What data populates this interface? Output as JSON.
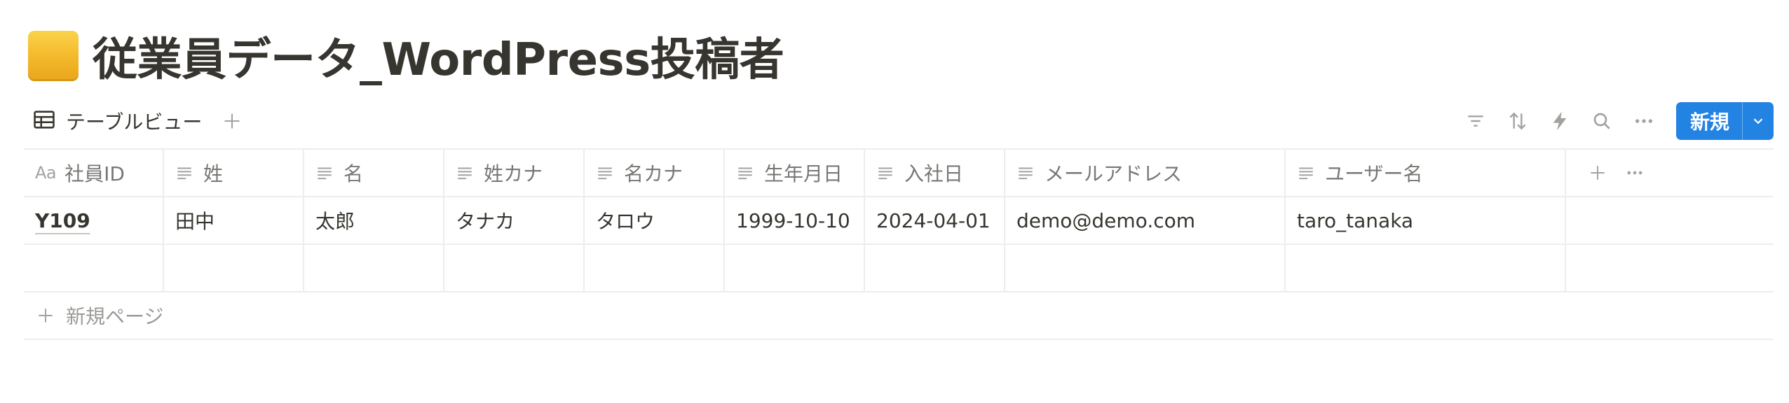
{
  "page": {
    "title": "従業員データ_WordPress投稿者"
  },
  "toolbar": {
    "view_label": "テーブルビュー",
    "new_button_label": "新規"
  },
  "table": {
    "id_prefix": "Aa",
    "columns": [
      {
        "label": "社員ID"
      },
      {
        "label": "姓"
      },
      {
        "label": "名"
      },
      {
        "label": "姓カナ"
      },
      {
        "label": "名カナ"
      },
      {
        "label": "生年月日"
      },
      {
        "label": "入社日"
      },
      {
        "label": "メールアドレス"
      },
      {
        "label": "ユーザー名"
      }
    ],
    "rows": [
      {
        "cells": [
          "Y109",
          "田中",
          "太郎",
          "タナカ",
          "タロウ",
          "1999-10-10",
          "2024-04-01",
          "demo@demo.com",
          "taro_tanaka"
        ]
      }
    ],
    "add_page_label": "新規ページ"
  },
  "colors": {
    "accent": "#2383e2",
    "icon": "#f3b72a"
  }
}
